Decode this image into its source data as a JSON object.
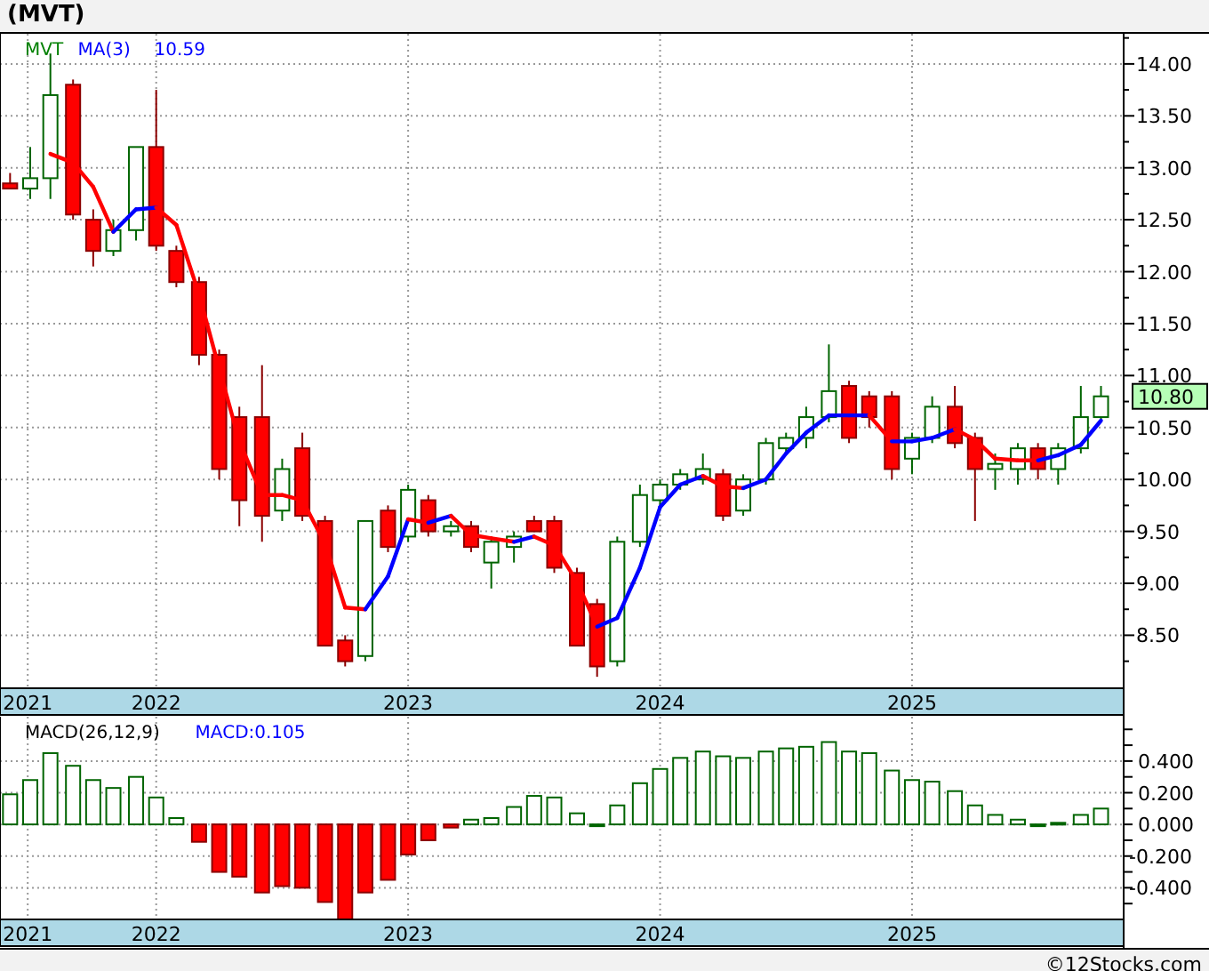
{
  "title": "(MVT)",
  "price_panel": {
    "legend": [
      {
        "text": "MVT",
        "color": "#008000"
      },
      {
        "text": "MA(3)",
        "color": "#0000ff"
      },
      {
        "text": "10.59",
        "color": "#0000ff"
      }
    ],
    "last_price": "10.80",
    "chart_data": {
      "type": "candlestick",
      "grid": true,
      "xlim": [
        2021.38,
        2025.84
      ],
      "ylim": [
        7.99,
        14.29
      ],
      "yticks": [
        {
          "value": 8.5,
          "label": "8.50"
        },
        {
          "value": 9,
          "label": "9.00"
        },
        {
          "value": 9.5,
          "label": "9.50"
        },
        {
          "value": 10,
          "label": "10.00"
        },
        {
          "value": 10.5,
          "label": "10.50"
        },
        {
          "value": 11,
          "label": "11.00"
        },
        {
          "value": 11.5,
          "label": "11.50"
        },
        {
          "value": 12,
          "label": "12.00"
        },
        {
          "value": 12.5,
          "label": "12.50"
        },
        {
          "value": 13,
          "label": "13.00"
        },
        {
          "value": 13.5,
          "label": "13.50"
        },
        {
          "value": 14,
          "label": "14.00"
        }
      ],
      "xticks": [
        {
          "value": 2021.49,
          "label": "2021"
        },
        {
          "value": 2022,
          "label": "2022"
        },
        {
          "value": 2023,
          "label": "2023"
        },
        {
          "value": 2024,
          "label": "2024"
        },
        {
          "value": 2025,
          "label": "2025"
        }
      ],
      "x": [
        2021.42,
        2021.5,
        2021.58,
        2021.67,
        2021.75,
        2021.83,
        2021.92,
        2022.0,
        2022.08,
        2022.17,
        2022.25,
        2022.33,
        2022.42,
        2022.5,
        2022.58,
        2022.67,
        2022.75,
        2022.83,
        2022.92,
        2023.0,
        2023.08,
        2023.17,
        2023.25,
        2023.33,
        2023.42,
        2023.5,
        2023.58,
        2023.67,
        2023.75,
        2023.83,
        2023.92,
        2024.0,
        2024.08,
        2024.17,
        2024.25,
        2024.33,
        2024.42,
        2024.5,
        2024.58,
        2024.67,
        2024.75,
        2024.83,
        2024.92,
        2025.0,
        2025.08,
        2025.17,
        2025.25,
        2025.33,
        2025.42,
        2025.5,
        2025.58,
        2025.67,
        2025.75
      ],
      "ohlc": [
        [
          12.85,
          12.95,
          12.8,
          12.8
        ],
        [
          12.8,
          13.2,
          12.7,
          12.9
        ],
        [
          12.9,
          14.1,
          12.7,
          13.7
        ],
        [
          13.8,
          13.85,
          12.5,
          12.55
        ],
        [
          12.5,
          12.6,
          12.05,
          12.2
        ],
        [
          12.2,
          12.5,
          12.15,
          12.4
        ],
        [
          12.4,
          13.2,
          12.3,
          13.2
        ],
        [
          13.2,
          13.75,
          12.2,
          12.25
        ],
        [
          12.2,
          12.25,
          11.85,
          11.9
        ],
        [
          11.9,
          11.95,
          11.1,
          11.2
        ],
        [
          11.2,
          11.25,
          10.0,
          10.1
        ],
        [
          10.6,
          10.7,
          9.55,
          9.8
        ],
        [
          10.6,
          11.1,
          9.4,
          9.65
        ],
        [
          9.7,
          10.2,
          9.6,
          10.1
        ],
        [
          10.3,
          10.45,
          9.6,
          9.65
        ],
        [
          9.6,
          9.65,
          8.4,
          8.4
        ],
        [
          8.45,
          8.5,
          8.2,
          8.25
        ],
        [
          8.3,
          9.6,
          8.25,
          9.6
        ],
        [
          9.7,
          9.75,
          9.3,
          9.35
        ],
        [
          9.45,
          9.95,
          9.4,
          9.9
        ],
        [
          9.8,
          9.85,
          9.45,
          9.5
        ],
        [
          9.5,
          9.6,
          9.45,
          9.55
        ],
        [
          9.55,
          9.6,
          9.3,
          9.35
        ],
        [
          9.2,
          9.45,
          8.95,
          9.4
        ],
        [
          9.35,
          9.5,
          9.2,
          9.45
        ],
        [
          9.6,
          9.65,
          9.5,
          9.5
        ],
        [
          9.6,
          9.65,
          9.1,
          9.15
        ],
        [
          9.1,
          9.15,
          8.4,
          8.4
        ],
        [
          8.8,
          8.85,
          8.1,
          8.2
        ],
        [
          8.25,
          9.45,
          8.2,
          9.4
        ],
        [
          9.4,
          9.95,
          9.35,
          9.85
        ],
        [
          9.8,
          10.0,
          9.75,
          9.95
        ],
        [
          9.95,
          10.1,
          9.9,
          10.05
        ],
        [
          10.0,
          10.25,
          9.95,
          10.1
        ],
        [
          10.05,
          10.1,
          9.6,
          9.65
        ],
        [
          9.7,
          10.05,
          9.65,
          10.0
        ],
        [
          10.0,
          10.4,
          9.95,
          10.35
        ],
        [
          10.3,
          10.45,
          10.25,
          10.4
        ],
        [
          10.4,
          10.7,
          10.3,
          10.6
        ],
        [
          10.6,
          11.3,
          10.55,
          10.85
        ],
        [
          10.9,
          10.95,
          10.35,
          10.4
        ],
        [
          10.8,
          10.85,
          10.5,
          10.6
        ],
        [
          10.8,
          10.85,
          10.0,
          10.1
        ],
        [
          10.2,
          10.45,
          10.05,
          10.4
        ],
        [
          10.4,
          10.8,
          10.35,
          10.7
        ],
        [
          10.7,
          10.9,
          10.3,
          10.35
        ],
        [
          10.4,
          10.45,
          9.6,
          10.1
        ],
        [
          10.1,
          10.25,
          9.9,
          10.15
        ],
        [
          10.1,
          10.35,
          9.95,
          10.3
        ],
        [
          10.3,
          10.35,
          10.0,
          10.1
        ],
        [
          10.1,
          10.35,
          9.95,
          10.3
        ],
        [
          10.3,
          10.9,
          10.25,
          10.6
        ],
        [
          10.6,
          10.9,
          10.55,
          10.8
        ]
      ]
    }
  },
  "macd_panel": {
    "legend": [
      {
        "text": "MACD(26,12,9)",
        "color": "#000000"
      },
      {
        "text": "MACD:0.105",
        "color": "#0000ff"
      }
    ],
    "chart_data": {
      "type": "bar",
      "grid": true,
      "xlim": [
        2021.38,
        2025.84
      ],
      "ylim": [
        -0.6,
        0.68
      ],
      "yticks": [
        {
          "value": -0.4,
          "label": "-0.400"
        },
        {
          "value": -0.2,
          "label": "-0.200"
        },
        {
          "value": 0,
          "label": "0.000"
        },
        {
          "value": 0.2,
          "label": "0.200"
        },
        {
          "value": 0.4,
          "label": "0.400"
        }
      ],
      "xticks": [
        {
          "value": 2021.49,
          "label": "2021"
        },
        {
          "value": 2022,
          "label": "2022"
        },
        {
          "value": 2023,
          "label": "2023"
        },
        {
          "value": 2024,
          "label": "2024"
        },
        {
          "value": 2025,
          "label": "2025"
        }
      ],
      "x": [
        2021.42,
        2021.5,
        2021.58,
        2021.67,
        2021.75,
        2021.83,
        2021.92,
        2022.0,
        2022.08,
        2022.17,
        2022.25,
        2022.33,
        2022.42,
        2022.5,
        2022.58,
        2022.67,
        2022.75,
        2022.83,
        2022.92,
        2023.0,
        2023.08,
        2023.17,
        2023.25,
        2023.33,
        2023.42,
        2023.5,
        2023.58,
        2023.67,
        2023.75,
        2023.83,
        2023.92,
        2024.0,
        2024.08,
        2024.17,
        2024.25,
        2024.33,
        2024.42,
        2024.5,
        2024.58,
        2024.67,
        2024.75,
        2024.83,
        2024.92,
        2025.0,
        2025.08,
        2025.17,
        2025.25,
        2025.33,
        2025.42,
        2025.5,
        2025.58,
        2025.67,
        2025.75
      ],
      "values": [
        0.19,
        0.28,
        0.45,
        0.37,
        0.28,
        0.23,
        0.3,
        0.17,
        0.04,
        -0.11,
        -0.3,
        -0.33,
        -0.43,
        -0.39,
        -0.4,
        -0.49,
        -0.6,
        -0.43,
        -0.35,
        -0.19,
        -0.1,
        -0.02,
        0.03,
        0.04,
        0.11,
        0.18,
        0.17,
        0.07,
        0.0,
        0.12,
        0.26,
        0.35,
        0.42,
        0.46,
        0.43,
        0.42,
        0.46,
        0.48,
        0.49,
        0.52,
        0.46,
        0.45,
        0.34,
        0.28,
        0.27,
        0.21,
        0.12,
        0.06,
        0.03,
        0.0,
        0.01,
        0.06,
        0.1
      ]
    }
  },
  "footer": {
    "copyright": "©12Stocks.com"
  }
}
